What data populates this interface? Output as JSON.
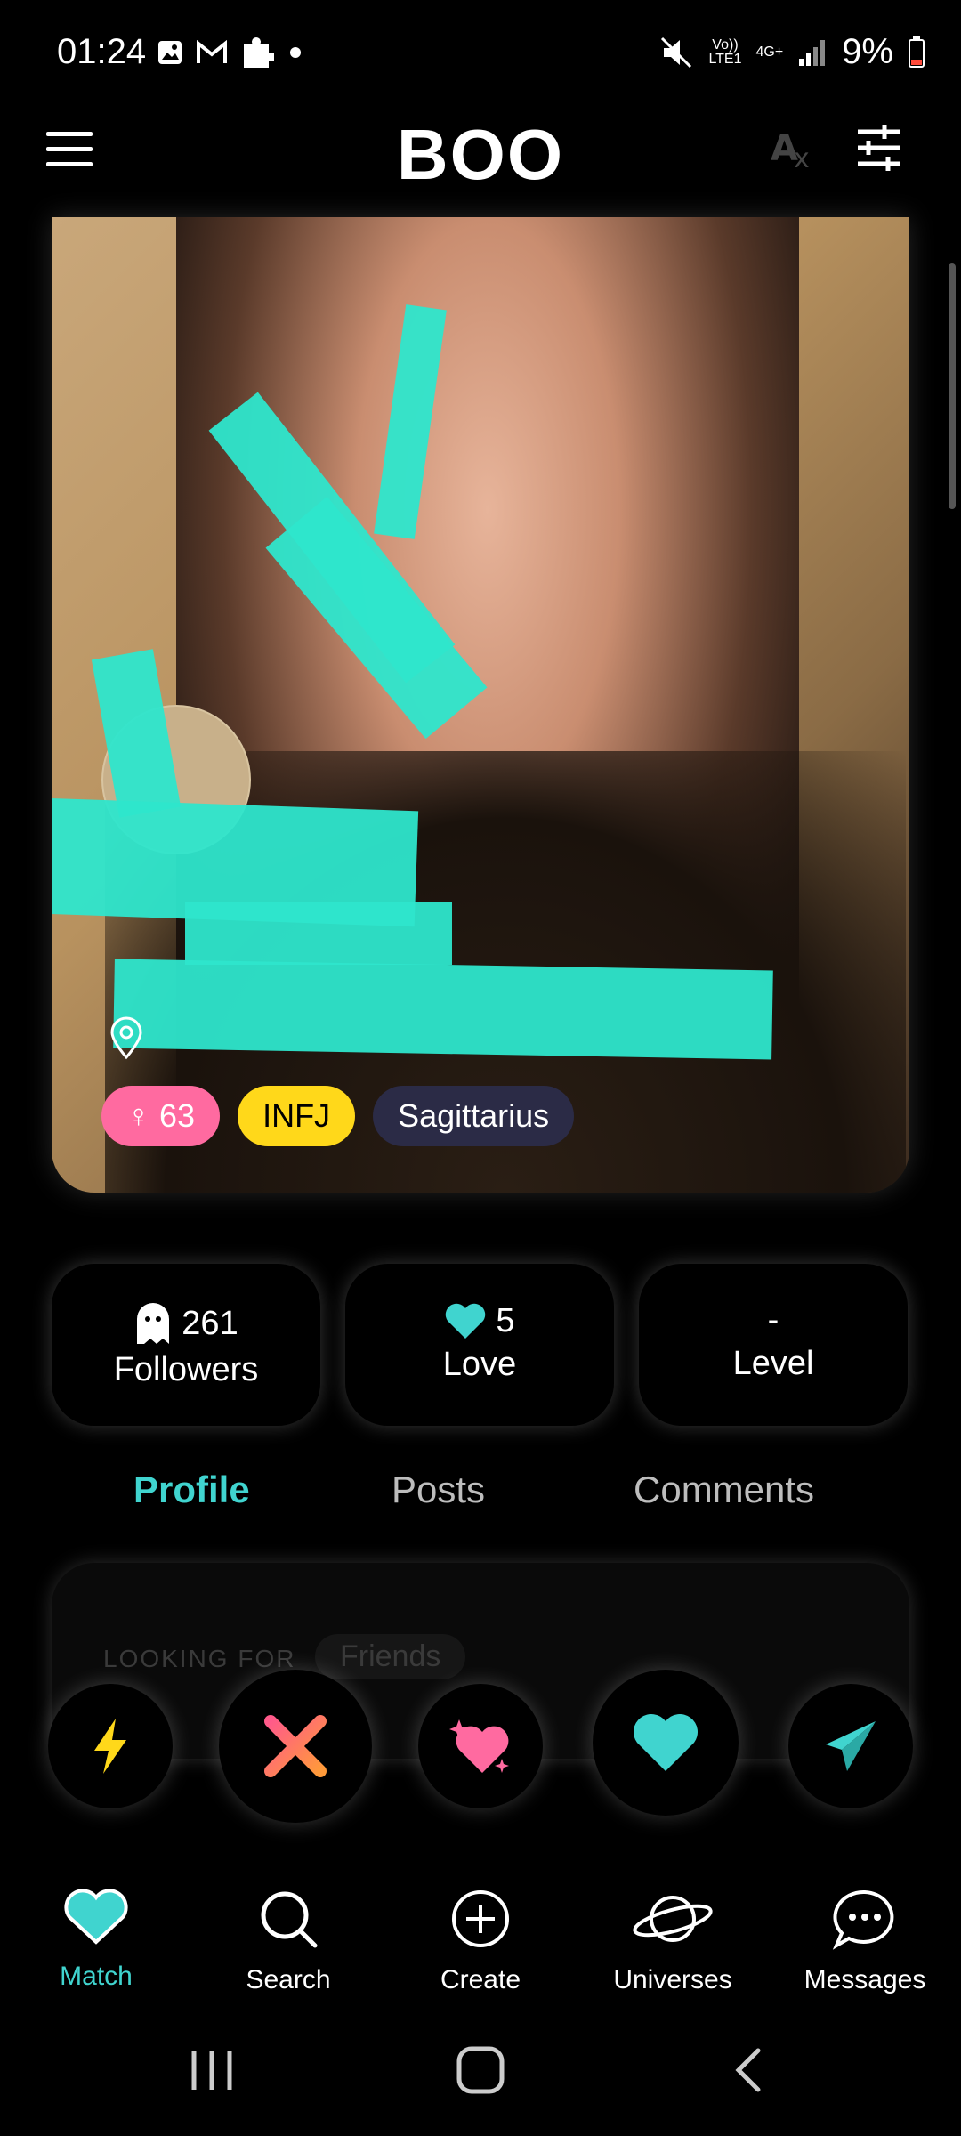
{
  "status_bar": {
    "time": "01:24",
    "network_top": "Vo))",
    "network_bottom": "LTE1",
    "network_type": "4G+",
    "battery": "9%",
    "icons": [
      "gallery-icon",
      "gmail-icon",
      "puzzle-icon",
      "dot-icon",
      "mute-icon",
      "signal-icon",
      "battery-icon"
    ]
  },
  "header": {
    "title": "BOO"
  },
  "profile": {
    "tags": {
      "age": "63",
      "mbti": "INFJ",
      "zodiac": "Sagittarius"
    }
  },
  "stats": [
    {
      "value": "261",
      "label": "Followers",
      "icon": "ghost-icon"
    },
    {
      "value": "5",
      "label": "Love",
      "icon": "heart-icon"
    },
    {
      "value": "-",
      "label": "Level",
      "icon": ""
    }
  ],
  "tabs": [
    {
      "label": "Profile",
      "active": true
    },
    {
      "label": "Posts",
      "active": false
    },
    {
      "label": "Comments",
      "active": false
    }
  ],
  "profile_card": {
    "looking_for_label": "LOOKING FOR",
    "looking_for_value": "Friends"
  },
  "bottom_nav": [
    {
      "label": "Match",
      "icon": "heart-icon",
      "active": true
    },
    {
      "label": "Search",
      "icon": "search-icon",
      "active": false
    },
    {
      "label": "Create",
      "icon": "plus-circle-icon",
      "active": false
    },
    {
      "label": "Universes",
      "icon": "planet-icon",
      "active": false
    },
    {
      "label": "Messages",
      "icon": "chat-icon",
      "active": false
    }
  ],
  "colors": {
    "accent": "#40d4cf",
    "age_tag": "#ff6aa0",
    "mbti_tag": "#ffd81a",
    "zodiac_tag": "#2b2b46",
    "redaction": "#2ee6cc"
  }
}
